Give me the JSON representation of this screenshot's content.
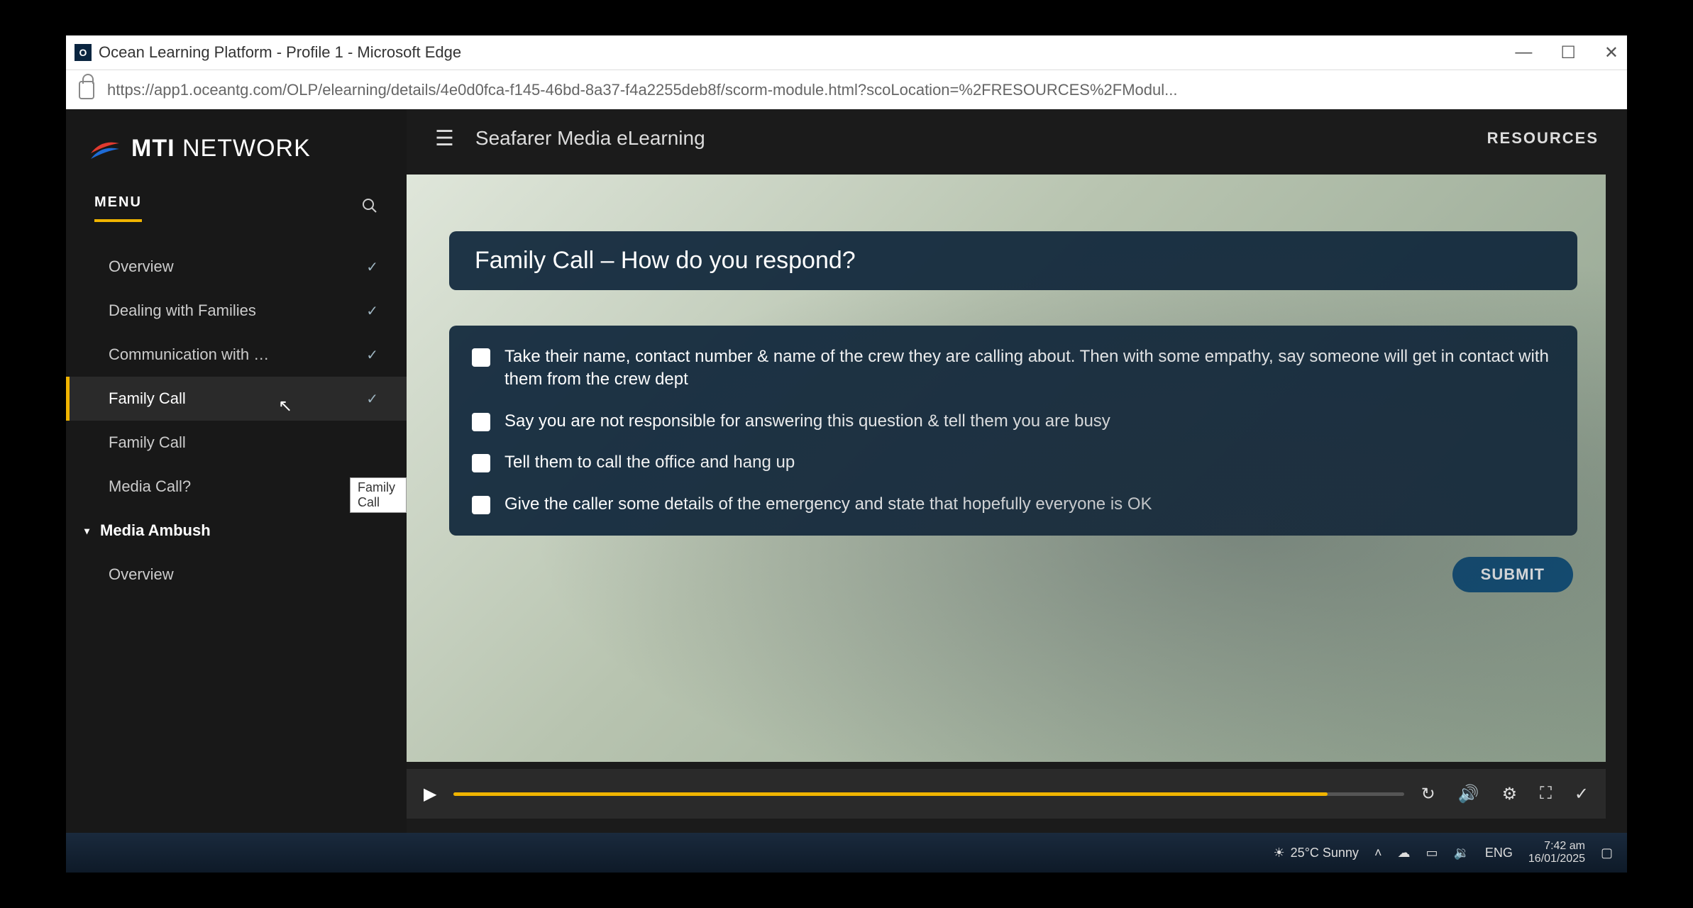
{
  "window": {
    "title": "Ocean Learning Platform - Profile 1 - Microsoft Edge",
    "url": "https://app1.oceantg.com/OLP/elearning/details/4e0d0fca-f145-46bd-8a37-f4a2255deb8f/scorm-module.html?scoLocation=%2FRESOURCES%2FModul..."
  },
  "brand": {
    "part1": "MTI",
    "part2": " NETWORK"
  },
  "sidebar": {
    "menu_label": "MENU",
    "items": [
      {
        "label": "Overview",
        "checked": true,
        "active": false,
        "section": false
      },
      {
        "label": "Dealing with Families",
        "checked": true,
        "active": false,
        "section": false
      },
      {
        "label": "Communication with …",
        "checked": true,
        "active": false,
        "section": false
      },
      {
        "label": "Family Call",
        "checked": true,
        "active": true,
        "section": false
      },
      {
        "label": "Family Call",
        "checked": false,
        "active": false,
        "section": false
      },
      {
        "label": "Media Call?",
        "checked": false,
        "active": false,
        "section": false
      },
      {
        "label": "Media Ambush",
        "checked": false,
        "active": false,
        "section": true
      },
      {
        "label": "Overview",
        "checked": false,
        "active": false,
        "section": false
      }
    ],
    "tooltip": "Family Call"
  },
  "header": {
    "course_title": "Seafarer Media eLearning",
    "resources": "RESOURCES"
  },
  "question": {
    "title": "Family Call – How do you respond?",
    "options": [
      "Take their name, contact number & name of the crew they are calling about. Then with some empathy, say someone will get in contact with them from the crew dept",
      "Say you are not responsible for answering this question & tell them you are busy",
      "Tell them to call the office and hang up",
      "Give the caller some details of the emergency and state that hopefully everyone is OK"
    ],
    "submit": "SUBMIT"
  },
  "taskbar": {
    "weather": "25°C  Sunny",
    "lang": "ENG",
    "time": "7:42 am",
    "date": "16/01/2025"
  }
}
